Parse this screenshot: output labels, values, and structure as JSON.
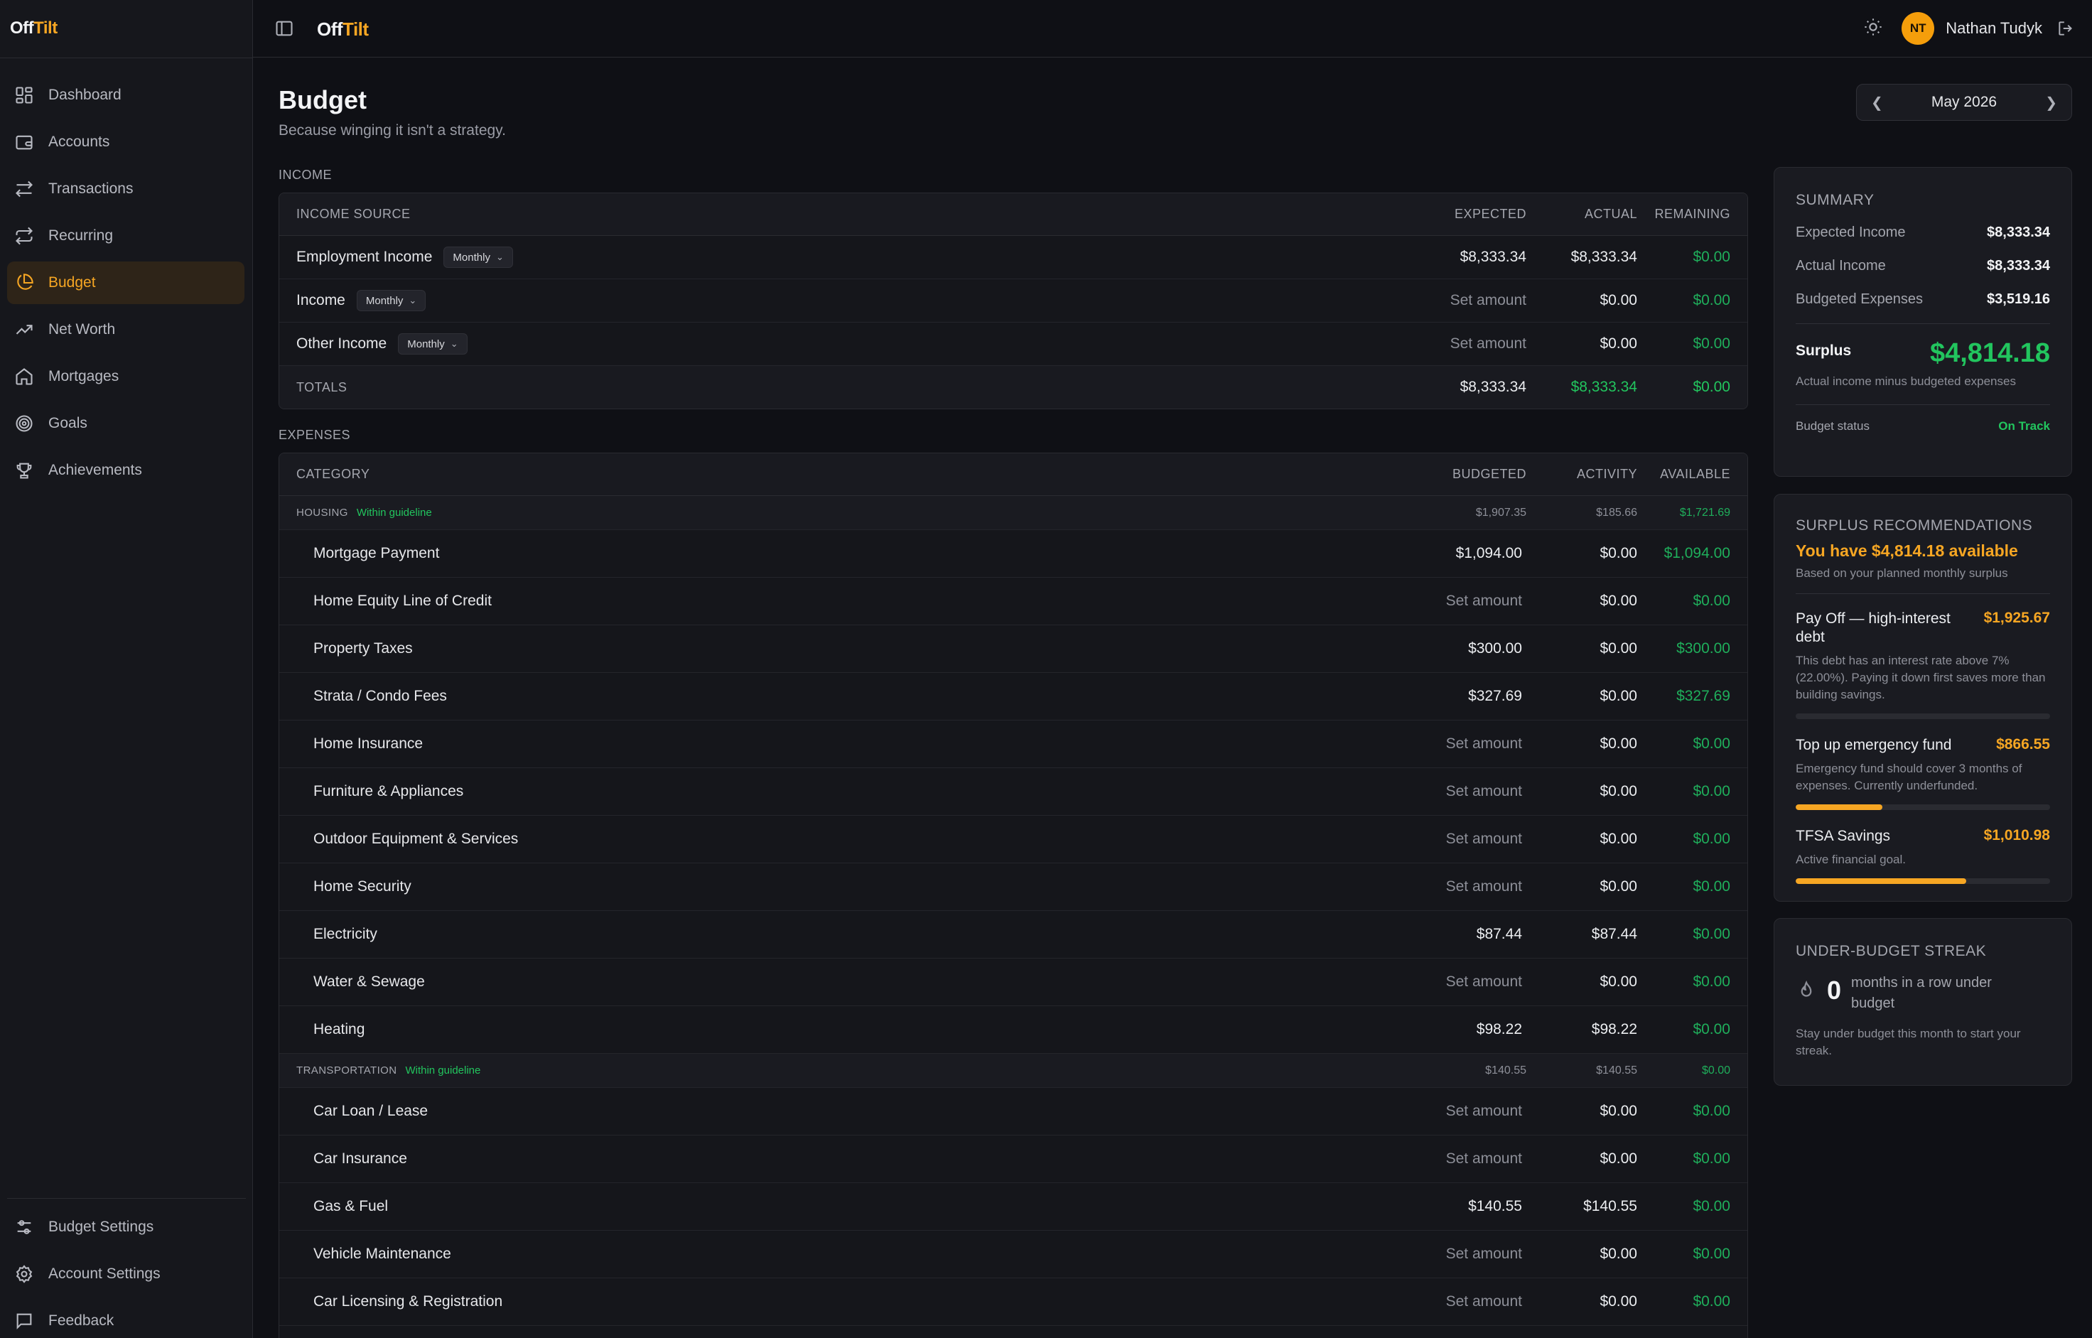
{
  "app": {
    "logo_off": "Off",
    "logo_tilt": "Tilt",
    "user_initials": "NT",
    "user_name": "Nathan Tudyk"
  },
  "sidebar": {
    "items": [
      {
        "label": "Dashboard",
        "icon": "dashboard-icon"
      },
      {
        "label": "Accounts",
        "icon": "wallet-icon"
      },
      {
        "label": "Transactions",
        "icon": "arrows-icon"
      },
      {
        "label": "Recurring",
        "icon": "repeat-icon"
      },
      {
        "label": "Budget",
        "icon": "pie-chart-icon",
        "active": true
      },
      {
        "label": "Net Worth",
        "icon": "trend-up-icon"
      },
      {
        "label": "Mortgages",
        "icon": "home-icon"
      },
      {
        "label": "Goals",
        "icon": "target-icon"
      },
      {
        "label": "Achievements",
        "icon": "trophy-icon"
      }
    ],
    "bottom_items": [
      {
        "label": "Budget Settings",
        "icon": "sliders-icon"
      },
      {
        "label": "Account Settings",
        "icon": "gear-icon"
      },
      {
        "label": "Feedback",
        "icon": "message-icon"
      }
    ]
  },
  "page": {
    "title": "Budget",
    "subtitle": "Because winging it isn't a strategy.",
    "month": "May 2026"
  },
  "income": {
    "section_label": "INCOME",
    "headers": [
      "INCOME SOURCE",
      "EXPECTED",
      "ACTUAL",
      "REMAINING"
    ],
    "rows": [
      {
        "name": "Employment Income",
        "freq": "Monthly",
        "expected": "$8,333.34",
        "actual": "$8,333.34",
        "remaining": "$0.00",
        "expected_set": true
      },
      {
        "name": "Income",
        "freq": "Monthly",
        "expected": "Set amount",
        "actual": "$0.00",
        "remaining": "$0.00",
        "expected_set": false
      },
      {
        "name": "Other Income",
        "freq": "Monthly",
        "expected": "Set amount",
        "actual": "$0.00",
        "remaining": "$0.00",
        "expected_set": false
      }
    ],
    "totals": {
      "label": "TOTALS",
      "expected": "$8,333.34",
      "actual": "$8,333.34",
      "remaining": "$0.00"
    }
  },
  "expenses": {
    "section_label": "EXPENSES",
    "headers": [
      "CATEGORY",
      "BUDGETED",
      "ACTIVITY",
      "AVAILABLE"
    ],
    "groups": [
      {
        "name": "HOUSING",
        "guideline": "Within guideline",
        "budgeted": "$1,907.35",
        "activity": "$185.66",
        "available": "$1,721.69",
        "rows": [
          {
            "name": "Mortgage Payment",
            "budgeted": "$1,094.00",
            "activity": "$0.00",
            "available": "$1,094.00",
            "set": true
          },
          {
            "name": "Home Equity Line of Credit",
            "budgeted": "Set amount",
            "activity": "$0.00",
            "available": "$0.00",
            "set": false
          },
          {
            "name": "Property Taxes",
            "budgeted": "$300.00",
            "activity": "$0.00",
            "available": "$300.00",
            "set": true
          },
          {
            "name": "Strata / Condo Fees",
            "budgeted": "$327.69",
            "activity": "$0.00",
            "available": "$327.69",
            "set": true
          },
          {
            "name": "Home Insurance",
            "budgeted": "Set amount",
            "activity": "$0.00",
            "available": "$0.00",
            "set": false
          },
          {
            "name": "Furniture & Appliances",
            "budgeted": "Set amount",
            "activity": "$0.00",
            "available": "$0.00",
            "set": false
          },
          {
            "name": "Outdoor Equipment & Services",
            "budgeted": "Set amount",
            "activity": "$0.00",
            "available": "$0.00",
            "set": false
          },
          {
            "name": "Home Security",
            "budgeted": "Set amount",
            "activity": "$0.00",
            "available": "$0.00",
            "set": false
          },
          {
            "name": "Electricity",
            "budgeted": "$87.44",
            "activity": "$87.44",
            "available": "$0.00",
            "set": true
          },
          {
            "name": "Water & Sewage",
            "budgeted": "Set amount",
            "activity": "$0.00",
            "available": "$0.00",
            "set": false
          },
          {
            "name": "Heating",
            "budgeted": "$98.22",
            "activity": "$98.22",
            "available": "$0.00",
            "set": true
          }
        ]
      },
      {
        "name": "TRANSPORTATION",
        "guideline": "Within guideline",
        "budgeted": "$140.55",
        "activity": "$140.55",
        "available": "$0.00",
        "rows": [
          {
            "name": "Car Loan / Lease",
            "budgeted": "Set amount",
            "activity": "$0.00",
            "available": "$0.00",
            "set": false
          },
          {
            "name": "Car Insurance",
            "budgeted": "Set amount",
            "activity": "$0.00",
            "available": "$0.00",
            "set": false
          },
          {
            "name": "Gas & Fuel",
            "budgeted": "$140.55",
            "activity": "$140.55",
            "available": "$0.00",
            "set": true
          },
          {
            "name": "Vehicle Maintenance",
            "budgeted": "Set amount",
            "activity": "$0.00",
            "available": "$0.00",
            "set": false
          },
          {
            "name": "Car Licensing & Registration",
            "budgeted": "Set amount",
            "activity": "$0.00",
            "available": "$0.00",
            "set": false
          }
        ]
      }
    ]
  },
  "summary": {
    "title": "SUMMARY",
    "expected_income_label": "Expected Income",
    "expected_income": "$8,333.34",
    "actual_income_label": "Actual Income",
    "actual_income": "$8,333.34",
    "budgeted_expenses_label": "Budgeted Expenses",
    "budgeted_expenses": "$3,519.16",
    "surplus_label": "Surplus",
    "surplus": "$4,814.18",
    "surplus_note": "Actual income minus budgeted expenses",
    "status_label": "Budget status",
    "status": "On Track"
  },
  "recommendations": {
    "title": "SURPLUS RECOMMENDATIONS",
    "headline": "You have $4,814.18 available",
    "sub": "Based on your planned monthly surplus",
    "items": [
      {
        "title": "Pay Off — high-interest debt",
        "amount": "$1,925.67",
        "desc": "This debt has an interest rate above 7% (22.00%). Paying it down first saves more than building savings.",
        "progress": 0
      },
      {
        "title": "Top up emergency fund",
        "amount": "$866.55",
        "desc": "Emergency fund should cover 3 months of expenses. Currently underfunded.",
        "progress": 0.34
      },
      {
        "title": "TFSA Savings",
        "amount": "$1,010.98",
        "desc": "Active financial goal.",
        "progress": 0.67
      }
    ]
  },
  "streak": {
    "title": "UNDER-BUDGET STREAK",
    "count": "0",
    "unit": "months in a row under budget",
    "note": "Stay under budget this month to start your streak."
  }
}
